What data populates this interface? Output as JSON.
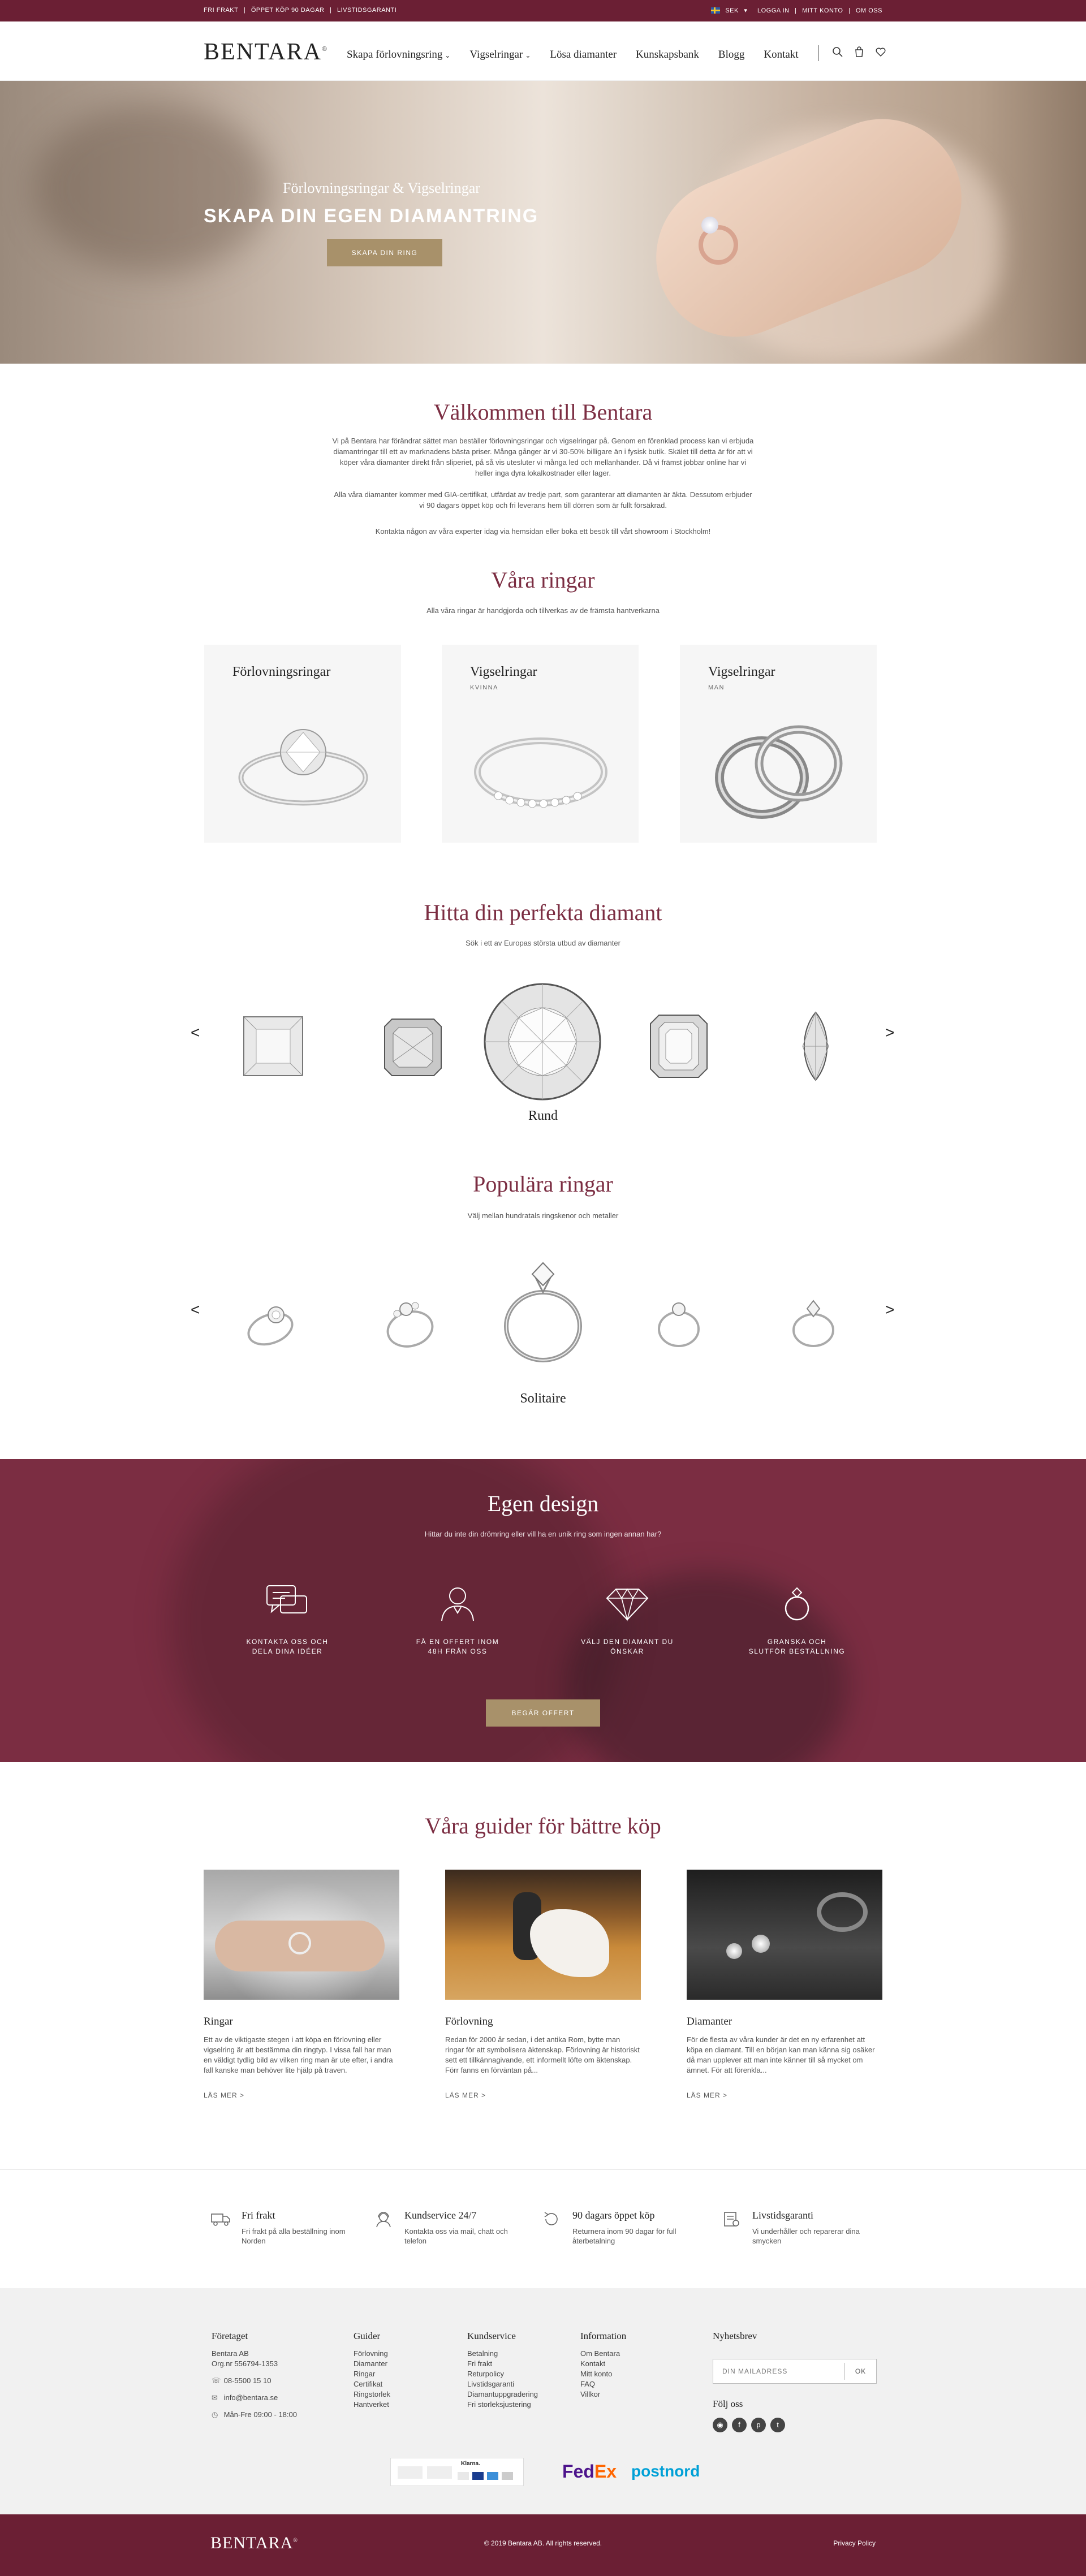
{
  "topbar": {
    "left": [
      "FRI FRAKT",
      "|",
      "ÖPPET KÖP 90 DAGAR",
      "|",
      "LIVSTIDSGARANTI"
    ],
    "currency": "SEK",
    "right": [
      "LOGGA IN",
      "|",
      "MITT KONTO",
      "|",
      "OM OSS"
    ]
  },
  "header": {
    "logo": "BENTARA",
    "nav": [
      {
        "label": "Skapa förlovningsring",
        "dropdown": true
      },
      {
        "label": "Vigselringar",
        "dropdown": true
      },
      {
        "label": "Lösa diamanter",
        "dropdown": false
      },
      {
        "label": "Kunskapsbank",
        "dropdown": false
      },
      {
        "label": "Blogg",
        "dropdown": false
      },
      {
        "label": "Kontakt",
        "dropdown": false
      }
    ],
    "icons": [
      "search-icon",
      "cart-icon",
      "heart-icon"
    ]
  },
  "hero": {
    "subtitle": "Förlovningsringar & Vigselringar",
    "title": "SKAPA DIN EGEN DIAMANTRING",
    "button": "SKAPA DIN RING"
  },
  "welcome": {
    "title": "Välkommen till Bentara",
    "p1": "Vi på Bentara har förändrat sättet man beställer förlovningsringar och vigselringar på. Genom en förenklad process kan vi erbjuda diamantringar till ett av marknadens bästa priser. Många gånger är vi 30-50% billigare än i fysisk butik. Skälet till detta är för att vi köper våra diamanter direkt från sliperiet, på så vis utesluter vi många led och mellanhänder. Då vi främst jobbar online har vi heller inga dyra lokalkostnader eller lager.",
    "p2": "Alla våra diamanter kommer med GIA-certifikat, utfärdat av tredje part, som garanterar att diamanten är äkta. Dessutom erbjuder vi 90 dagars öppet köp och fri leverans hem till dörren som är fullt försäkrad.",
    "p3": "Kontakta någon av våra experter idag via hemsidan eller boka ett besök till vårt showroom i Stockholm!"
  },
  "rings": {
    "title": "Våra ringar",
    "subtitle": "Alla våra ringar är handgjorda och tillverkas av de främsta hantverkarna",
    "cards": [
      {
        "name": "Förlovningsringar",
        "tag": ""
      },
      {
        "name": "Vigselringar",
        "tag": "KVINNA"
      },
      {
        "name": "Vigselringar",
        "tag": "MAN"
      }
    ]
  },
  "diamonds": {
    "title": "Hitta din perfekta diamant",
    "subtitle": "Sök i ett av Europas största utbud av diamanter",
    "selected": "Rund",
    "prev": "<",
    "next": ">"
  },
  "popular": {
    "title": "Populära ringar",
    "subtitle": "Välj mellan hundratals ringskenor och metaller",
    "selected": "Solitaire",
    "prev": "<",
    "next": ">"
  },
  "design": {
    "title": "Egen design",
    "subtitle": "Hittar du inte din drömring eller vill ha en unik ring som ingen annan har?",
    "steps": [
      {
        "icon": "chat-icon",
        "label1": "KONTAKTA OSS OCH",
        "label2": "DELA DINA IDÉER"
      },
      {
        "icon": "person-icon",
        "label1": "FÅ EN OFFERT INOM",
        "label2": "48H FRÅN OSS"
      },
      {
        "icon": "diamond-icon",
        "label1": "VÄLJ DEN DIAMANT DU",
        "label2": "ÖNSKAR"
      },
      {
        "icon": "ring-icon",
        "label1": "GRANSKA OCH",
        "label2": "SLUTFÖR BESTÄLLNING"
      }
    ],
    "button": "BEGÄR OFFERT"
  },
  "guides": {
    "title": "Våra guider för bättre köp",
    "items": [
      {
        "title": "Ringar",
        "text": "Ett av de viktigaste stegen i att köpa en förlovning eller vigselring är att bestämma din ringtyp. I vissa fall har man en väldigt tydlig bild av vilken ring man är ute efter, i andra fall kanske man behöver lite hjälp på traven.",
        "more": "LÄS MER >"
      },
      {
        "title": "Förlovning",
        "text": "Redan för 2000 år sedan, i det antika Rom, bytte man ringar för att symbolisera äktenskap. Förlovning är historiskt sett ett tillkännagivande, ett informellt löfte om äktenskap. Förr fanns en förväntan på...",
        "more": "LÄS MER >"
      },
      {
        "title": "Diamanter",
        "text": "För de flesta av våra kunder är det en ny erfarenhet att köpa en diamant. Till en början kan man känna sig osäker då man upplever att man inte känner till så mycket om ämnet. För att förenkla...",
        "more": "LÄS MER >"
      }
    ]
  },
  "features": [
    {
      "icon": "truck-icon",
      "title": "Fri frakt",
      "text": "Fri frakt på alla beställning inom Norden"
    },
    {
      "icon": "support-icon",
      "title": "Kundservice 24/7",
      "text": "Kontakta oss via mail, chatt och telefon"
    },
    {
      "icon": "return-icon",
      "title": "90 dagars öppet köp",
      "text": "Returnera inom 90 dagar för full återbetalning"
    },
    {
      "icon": "warranty-icon",
      "title": "Livstidsgaranti",
      "text": "Vi underhåller och reparerar dina smycken"
    }
  ],
  "footer": {
    "company": {
      "h": "Företaget",
      "lines": [
        "Bentara AB",
        "Org.nr 556794-1353"
      ],
      "phone": "08-5500 15 10",
      "email": "info@bentara.se",
      "hours": "Mån-Fre 09:00 - 18:00"
    },
    "cols": [
      {
        "h": "Guider",
        "items": [
          "Förlovning",
          "Diamanter",
          "Ringar",
          "Certifikat",
          "Ringstorlek",
          "Hantverket"
        ]
      },
      {
        "h": "Kundservice",
        "items": [
          "Betalning",
          "Fri frakt",
          "Returpolicy",
          "Livstidsgaranti",
          "Diamantuppgradering",
          "Fri storleksjustering"
        ]
      },
      {
        "h": "Information",
        "items": [
          "Om Bentara",
          "Kontakt",
          "Mitt konto",
          "FAQ",
          "Villkor"
        ]
      }
    ],
    "newsletter": {
      "h": "Nyhetsbrev",
      "placeholder": "DIN MAILADRESS",
      "button": "OK"
    },
    "follow": "Följ oss",
    "payments": {
      "klarna": "Klarna.",
      "fedex_a": "Fed",
      "fedex_b": "Ex",
      "postnord": "postnord"
    }
  },
  "bottom": {
    "logo": "BENTARA",
    "copyright": "© 2019 Bentara AB. All rights reserved.",
    "privacy": "Privacy Policy"
  },
  "colors": {
    "maroon": "#7b2d42",
    "gold": "#a8916a",
    "topbar": "#6b1f34"
  }
}
